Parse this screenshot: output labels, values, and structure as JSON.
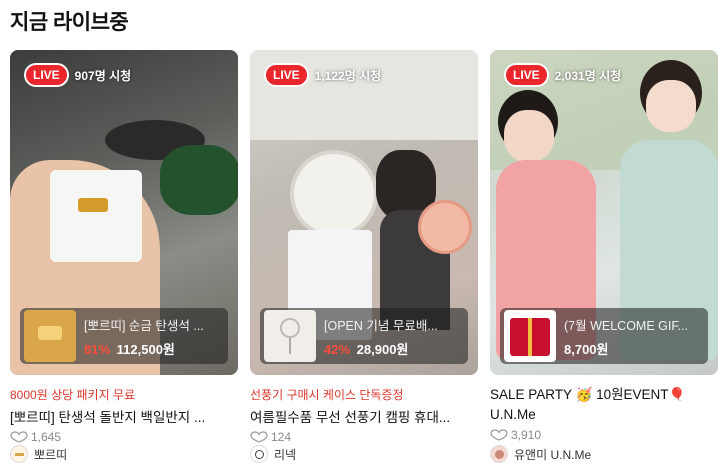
{
  "section": {
    "title": "지금 라이브중"
  },
  "cards": [
    {
      "live_label": "LIVE",
      "viewers": "907명 시청",
      "product_name": "[뽀르띠] 순금 탄생석 ...",
      "discount": "81%",
      "price": "112,500원",
      "promo": "8000원 상당 패키지 무료",
      "title": "[뽀르띠] 탄생석 돌반지 백일반지 ...",
      "likes": "1,645",
      "seller": "뽀르띠",
      "colors": {
        "product_bg": "#d9a64a"
      }
    },
    {
      "live_label": "LIVE",
      "viewers": "1,122명 시청",
      "product_name": "[OPEN 기념 무료배...",
      "discount": "42%",
      "price": "28,900원",
      "promo": "선풍기 구매시 케이스 단독증정",
      "title": "여름필수품 무선 선풍기 캠핑 휴대...",
      "likes": "124",
      "seller": "리넥",
      "colors": {
        "product_bg": "#f1eeea"
      }
    },
    {
      "live_label": "LIVE",
      "viewers": "2,031명 시청",
      "product_name": "(7월 WELCOME GIF...",
      "discount": "",
      "price": "8,700원",
      "promo": "",
      "title": "SALE PARTY 🥳 10원EVENT🎈U.N.Me",
      "likes": "3,910",
      "seller": "유앤미 U.N.Me",
      "colors": {
        "product_bg": "#c8102e"
      }
    }
  ],
  "colors": {
    "live_red": "#e8262b",
    "promo_red": "#e0352b",
    "discount_red": "#ff4d3a"
  },
  "icons": {
    "likes": "heart-outline-icon"
  }
}
